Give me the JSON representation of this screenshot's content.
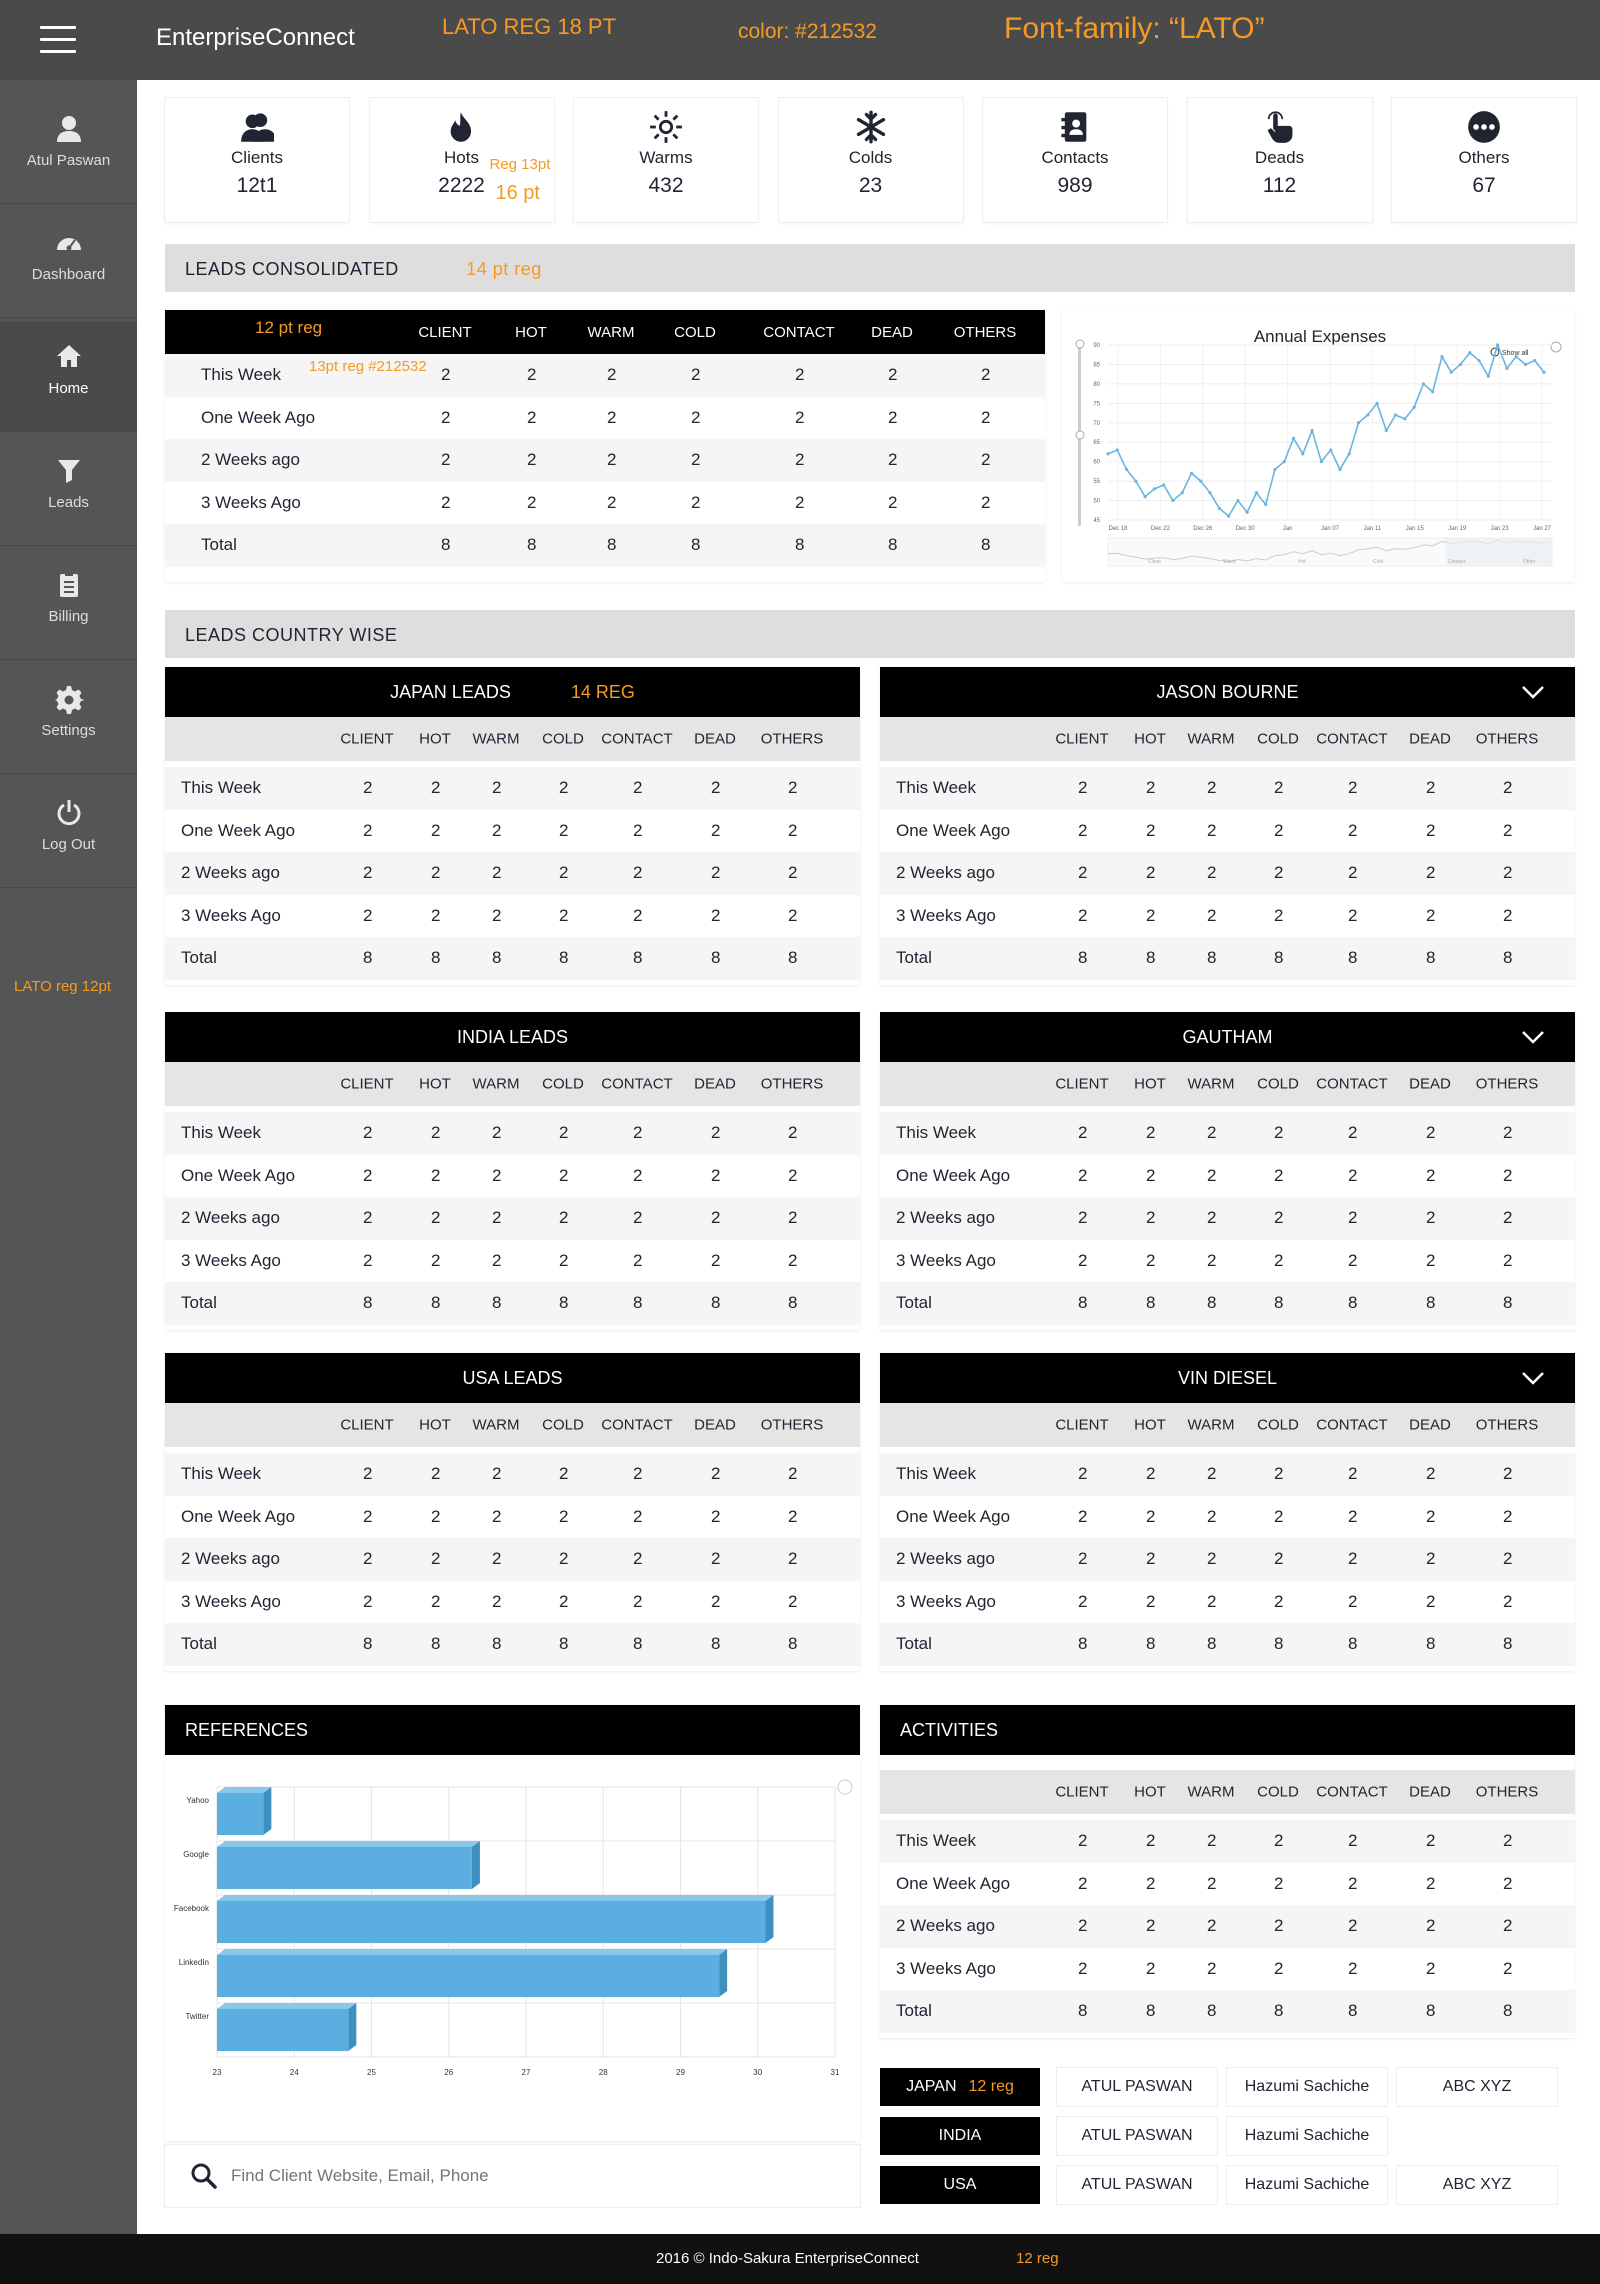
{
  "header": {
    "brand": "EnterpriseConnect",
    "note_size": "LATO REG 18 PT",
    "note_color": "color: #212532",
    "note_font": "Font-family: “LATO”"
  },
  "sidebar": {
    "items": [
      {
        "label": "Atul Paswan",
        "icon": "user-icon"
      },
      {
        "label": "Dashboard",
        "icon": "speedometer-icon"
      },
      {
        "label": "Home",
        "icon": "home-icon"
      },
      {
        "label": "Leads",
        "icon": "funnel-icon"
      },
      {
        "label": "Billing",
        "icon": "clipboard-icon"
      },
      {
        "label": "Settings",
        "icon": "gear-icon"
      },
      {
        "label": "Log Out",
        "icon": "power-icon"
      }
    ],
    "note": "LATO  reg  12pt"
  },
  "stats": [
    {
      "label": "Clients",
      "value": "12t1",
      "icon": "users-icon"
    },
    {
      "label": "Hots",
      "value": "2222",
      "icon": "flame-icon",
      "note_a": "Reg 13pt",
      "note_b": "16 pt"
    },
    {
      "label": "Warms",
      "value": "432",
      "icon": "sun-icon"
    },
    {
      "label": "Colds",
      "value": "23",
      "icon": "snowflake-icon"
    },
    {
      "label": "Contacts",
      "value": "989",
      "icon": "contact-book-icon"
    },
    {
      "label": "Deads",
      "value": "112",
      "icon": "hand-icon"
    },
    {
      "label": "Others",
      "value": "67",
      "icon": "more-icon"
    }
  ],
  "consolidated": {
    "title": "LEADS CONSOLIDATED",
    "note": "14 pt reg",
    "head_note": "12 pt reg",
    "row_note": "13pt reg #212532"
  },
  "columns": [
    "CLIENT",
    "HOT",
    "WARM",
    "COLD",
    "CONTACT",
    "DEAD",
    "OTHERS"
  ],
  "consolidated_rows": [
    {
      "label": "This Week",
      "values": [
        "2",
        "2",
        "2",
        "2",
        "2",
        "2",
        "2"
      ]
    },
    {
      "label": "One Week Ago",
      "values": [
        "2",
        "2",
        "2",
        "2",
        "2",
        "2",
        "2"
      ]
    },
    {
      "label": "2 Weeks ago",
      "values": [
        "2",
        "2",
        "2",
        "2",
        "2",
        "2",
        "2"
      ]
    },
    {
      "label": "3 Weeks Ago",
      "values": [
        "2",
        "2",
        "2",
        "2",
        "2",
        "2",
        "2"
      ]
    },
    {
      "label": "Total",
      "values": [
        "8",
        "8",
        "8",
        "8",
        "8",
        "8",
        "8"
      ]
    }
  ],
  "expenses_chart": {
    "title": "Annual Expenses",
    "show_all": "Show all",
    "yticks": [
      "90",
      "85",
      "80",
      "75",
      "70",
      "65",
      "60",
      "55",
      "50",
      "45"
    ],
    "xticks": [
      "Dec 18",
      "Dec 22",
      "Dec 26",
      "Dec 30",
      "Jan",
      "Jan 07",
      "Jan 11",
      "Jan 15",
      "Jan 19",
      "Jan 23",
      "Jan 27"
    ],
    "nav_labels": [
      "Client",
      "Warm",
      "Hot",
      "Cold",
      "Contact",
      "Other"
    ],
    "color": "#6cb4e0"
  },
  "country": {
    "title": "LEADS COUNTRY WISE"
  },
  "panels": [
    {
      "title": "JAPAN LEADS",
      "note": "14 REG",
      "chevron": false
    },
    {
      "title": "JASON BOURNE",
      "chevron": true
    },
    {
      "title": "INDIA LEADS",
      "chevron": false
    },
    {
      "title": "GAUTHAM",
      "chevron": true
    },
    {
      "title": "USA LEADS",
      "chevron": false
    },
    {
      "title": "VIN DIESEL",
      "chevron": true
    }
  ],
  "panel_rows": [
    {
      "label": "This Week",
      "values": [
        "2",
        "2",
        "2",
        "2",
        "2",
        "2",
        "2"
      ]
    },
    {
      "label": "One Week Ago",
      "values": [
        "2",
        "2",
        "2",
        "2",
        "2",
        "2",
        "2"
      ]
    },
    {
      "label": "2 Weeks ago",
      "values": [
        "2",
        "2",
        "2",
        "2",
        "2",
        "2",
        "2"
      ]
    },
    {
      "label": "3 Weeks Ago",
      "values": [
        "2",
        "2",
        "2",
        "2",
        "2",
        "2",
        "2"
      ]
    },
    {
      "label": "Total",
      "values": [
        "8",
        "8",
        "8",
        "8",
        "8",
        "8",
        "8"
      ]
    }
  ],
  "references": {
    "title": "REFERENCES"
  },
  "activities": {
    "title": "ACTIVITIES"
  },
  "chart_data": {
    "type": "bar",
    "orientation": "horizontal",
    "categories": [
      "Yahoo",
      "Google",
      "Facebook",
      "LinkedIn",
      "Twitter"
    ],
    "values": [
      23.6,
      26.3,
      30.1,
      29.5,
      24.7
    ],
    "xlim": [
      23,
      31
    ],
    "xticks": [
      "23",
      "24",
      "25",
      "26",
      "27",
      "28",
      "29",
      "30",
      "31"
    ],
    "grid": true,
    "color": "#5aafe0"
  },
  "assign": [
    {
      "country": "JAPAN",
      "note": "12 reg",
      "people": [
        "ATUL PASWAN",
        "Hazumi Sachiche",
        "ABC XYZ"
      ]
    },
    {
      "country": "INDIA",
      "people": [
        "ATUL PASWAN",
        "Hazumi Sachiche"
      ]
    },
    {
      "country": "USA",
      "people": [
        "ATUL PASWAN",
        "Hazumi Sachiche",
        "ABC XYZ"
      ]
    }
  ],
  "search": {
    "placeholder": "Find Client Website, Email, Phone"
  },
  "footer": {
    "text": "2016 © Indo-Sakura EnterpriseConnect",
    "note": "12 reg"
  }
}
